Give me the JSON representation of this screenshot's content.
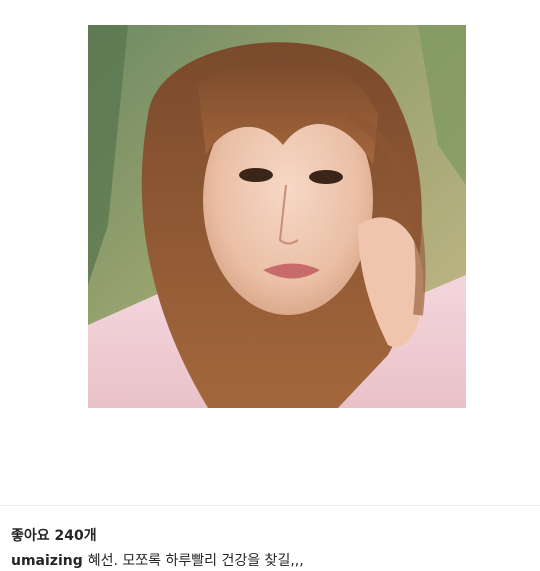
{
  "post": {
    "image": {
      "subject": "portrait-photo"
    },
    "likes_label": "좋아요 240개",
    "caption": {
      "username": "umaizing",
      "text": "혜선. 모쪼록 하루빨리 건강을 찾길,,,"
    }
  }
}
